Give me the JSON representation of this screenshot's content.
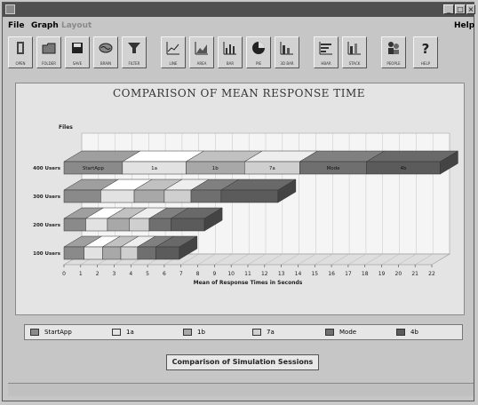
{
  "window": {
    "title": ""
  },
  "menu": {
    "file": "File",
    "graph": "Graph",
    "layout": "Layout",
    "help": "Help"
  },
  "toolbar": [
    {
      "label": "OPEN",
      "icon": "door-icon"
    },
    {
      "label": "FOLDER",
      "icon": "folder-icon"
    },
    {
      "label": "SAVE",
      "icon": "save-icon"
    },
    {
      "label": "BRAIN",
      "icon": "brain-icon"
    },
    {
      "label": "FILTER",
      "icon": "filter-icon"
    },
    {
      "label": "LINE",
      "icon": "line-chart-icon"
    },
    {
      "label": "AREA",
      "icon": "area-chart-icon"
    },
    {
      "label": "BAR",
      "icon": "bar-chart-icon"
    },
    {
      "label": "PIE",
      "icon": "pie-chart-icon"
    },
    {
      "label": "3D BAR",
      "icon": "3d-bar-icon"
    },
    {
      "label": "HBAR",
      "icon": "hbar-chart-icon"
    },
    {
      "label": "STACK",
      "icon": "stacked-bar-icon"
    },
    {
      "label": "PEOPLE",
      "icon": "people-icon"
    },
    {
      "label": "HELP",
      "icon": "help-icon"
    }
  ],
  "chart_data": {
    "type": "bar",
    "orientation": "horizontal-stacked-3d",
    "title": "COMPARISON OF MEAN RESPONSE TIME",
    "ylabel": "Files",
    "xlabel": "Mean of Response Times in Seconds",
    "categories": [
      "400 Users",
      "300 Users",
      "200 Users",
      "100 Users"
    ],
    "x_ticks": [
      "0",
      "1",
      "2",
      "3",
      "4",
      "5",
      "6",
      "7",
      "8",
      "9",
      "10",
      "11",
      "12",
      "13",
      "14",
      "15",
      "16",
      "17",
      "18",
      "19",
      "20",
      "21",
      "22"
    ],
    "xlim": [
      0,
      22
    ],
    "grid": true,
    "legend_position": "bottom",
    "series": [
      {
        "name": "StartApp",
        "color": "#8a8a8a",
        "values": [
          3.5,
          2.2,
          1.3,
          1.2
        ]
      },
      {
        "name": "1a",
        "color": "#e2e2e2",
        "values": [
          3.8,
          2.0,
          1.3,
          1.1
        ]
      },
      {
        "name": "1b",
        "color": "#a8a8a8",
        "values": [
          3.5,
          1.8,
          1.3,
          1.1
        ]
      },
      {
        "name": "7a",
        "color": "#cfcfcf",
        "values": [
          3.3,
          1.6,
          1.2,
          1.0
        ]
      },
      {
        "name": "Mode",
        "color": "#6f6f6f",
        "values": [
          4.0,
          1.8,
          1.3,
          1.1
        ]
      },
      {
        "name": "4b",
        "color": "#5b5b5b",
        "values": [
          4.4,
          3.4,
          2.0,
          1.4
        ]
      }
    ],
    "bar_labels": [
      "StartApp",
      "1a",
      "1b",
      "7a",
      "Mode",
      "4b"
    ]
  },
  "footer": {
    "button_label": "Comparison of Simulation Sessions"
  }
}
